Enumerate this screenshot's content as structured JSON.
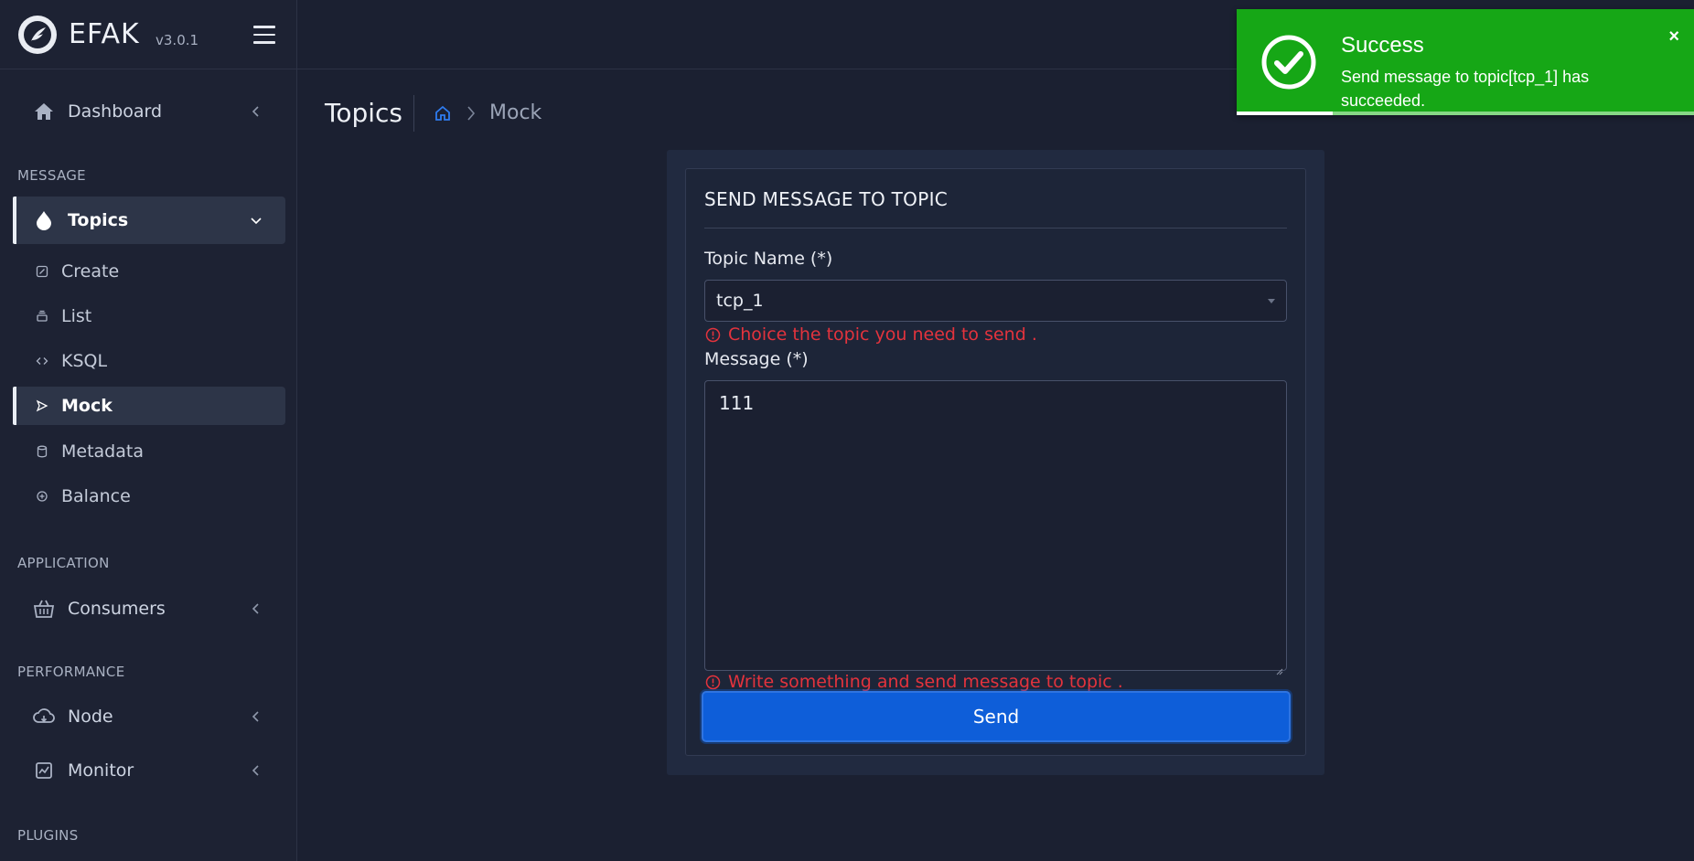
{
  "app": {
    "name": "EFAK",
    "version": "v3.0.1"
  },
  "sidebar": {
    "dashboard": {
      "label": "Dashboard",
      "icon": "home-icon"
    },
    "sections": {
      "message": "MESSAGE",
      "application": "APPLICATION",
      "performance": "PERFORMANCE",
      "plugins": "PLUGINS"
    },
    "topics": {
      "label": "Topics",
      "icon": "droplet-icon",
      "expanded": true,
      "children": [
        {
          "label": "Create",
          "icon": "edit-icon"
        },
        {
          "label": "List",
          "icon": "list-icon"
        },
        {
          "label": "KSQL",
          "icon": "code-icon"
        },
        {
          "label": "Mock",
          "icon": "send-icon",
          "active": true
        },
        {
          "label": "Metadata",
          "icon": "database-icon"
        },
        {
          "label": "Balance",
          "icon": "balance-icon"
        }
      ]
    },
    "consumers": {
      "label": "Consumers",
      "icon": "basket-icon"
    },
    "node": {
      "label": "Node",
      "icon": "cloud-icon"
    },
    "monitor": {
      "label": "Monitor",
      "icon": "chart-icon"
    }
  },
  "page": {
    "title": "Topics",
    "breadcrumb_current": "Mock"
  },
  "form": {
    "card_title": "SEND MESSAGE TO TOPIC",
    "topic_label": "Topic Name (*)",
    "topic_value": "tcp_1",
    "topic_hint": "Choice the topic you need to send .",
    "message_label": "Message (*)",
    "message_value": "111",
    "message_hint": "Write something and send message to topic .",
    "send_label": "Send"
  },
  "toast": {
    "title": "Success",
    "message": "Send message to topic[tcp_1] has succeeded.",
    "close": "×",
    "color": "#16a716",
    "progress_fraction": 0.21
  },
  "colors": {
    "background": "#1b2031",
    "sidebar": "#1d2233",
    "accent": "#0e5ed9",
    "error": "#e3333d"
  }
}
